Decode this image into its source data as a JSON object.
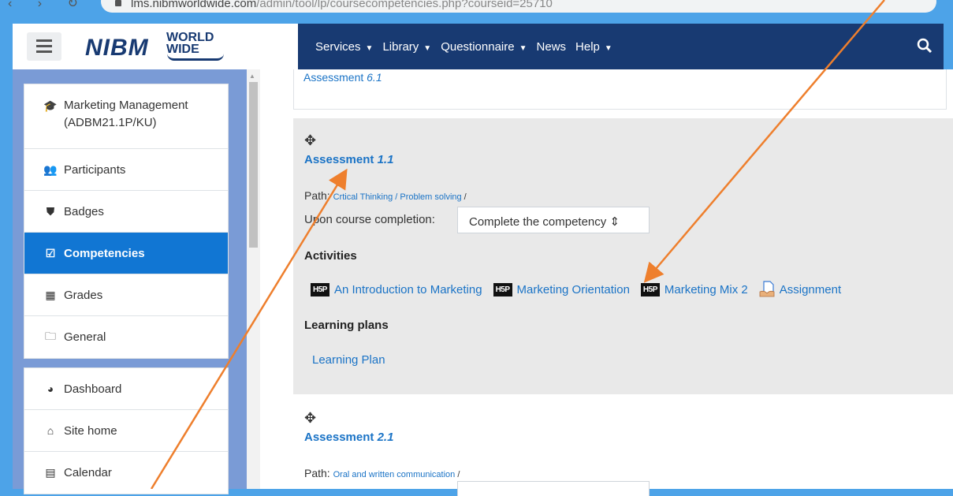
{
  "browser": {
    "url_host": "lms.nibmworldwide.com",
    "url_path": "/admin/tool/lp/coursecompetencies.php?courseid=25710"
  },
  "navbar": {
    "logo_main": "NIBM",
    "logo_world": "WORLD",
    "logo_wide": "WIDE",
    "menu": [
      {
        "label": "Services"
      },
      {
        "label": "Library"
      },
      {
        "label": "Questionnaire"
      },
      {
        "label": "News"
      },
      {
        "label": "Help"
      }
    ],
    "colors": {
      "navbar": "#183a72",
      "accent": "#1176d3",
      "arrow": "#ee7f2d"
    }
  },
  "sidebar": {
    "course_title": "Marketing Management",
    "course_code": "(ADBM21.1P/KU)",
    "items": [
      {
        "label": "Participants",
        "icon": "users-icon"
      },
      {
        "label": "Badges",
        "icon": "shield-icon"
      },
      {
        "label": "Competencies",
        "icon": "check-square-icon"
      },
      {
        "label": "Grades",
        "icon": "table-icon"
      },
      {
        "label": "General",
        "icon": "folder-icon"
      }
    ],
    "items2": [
      {
        "label": "Dashboard",
        "icon": "dashboard-icon"
      },
      {
        "label": "Site home",
        "icon": "home-icon"
      },
      {
        "label": "Calendar",
        "icon": "calendar-icon"
      }
    ]
  },
  "main": {
    "prev_assessment_prefix": "Assessment ",
    "prev_assessment_num": "6.1",
    "comp1": {
      "title_prefix": "Assessment ",
      "title_num": "1.1",
      "path_label": "Path:",
      "path_value": "Crtical Thinking / Problem solving",
      "path_sep": " /",
      "upon_label": "Upon course completion:",
      "upon_value": "Complete the competency",
      "activities_heading": "Activities",
      "activities": [
        {
          "label": "An Introduction to Marketing",
          "icon": "h5p-icon"
        },
        {
          "label": "Marketing Orientation",
          "icon": "h5p-icon"
        },
        {
          "label": "Marketing Mix 2",
          "icon": "h5p-icon"
        },
        {
          "label": "Assignment",
          "icon": "assignment-icon"
        }
      ],
      "h5p_badge": "H5P",
      "plans_heading": "Learning plans",
      "plan_link": "Learning Plan"
    },
    "comp2": {
      "title_prefix": "Assessment ",
      "title_num": "2.1",
      "path_label": "Path:",
      "path_value": "Oral and written communication",
      "path_sep": " /"
    }
  }
}
